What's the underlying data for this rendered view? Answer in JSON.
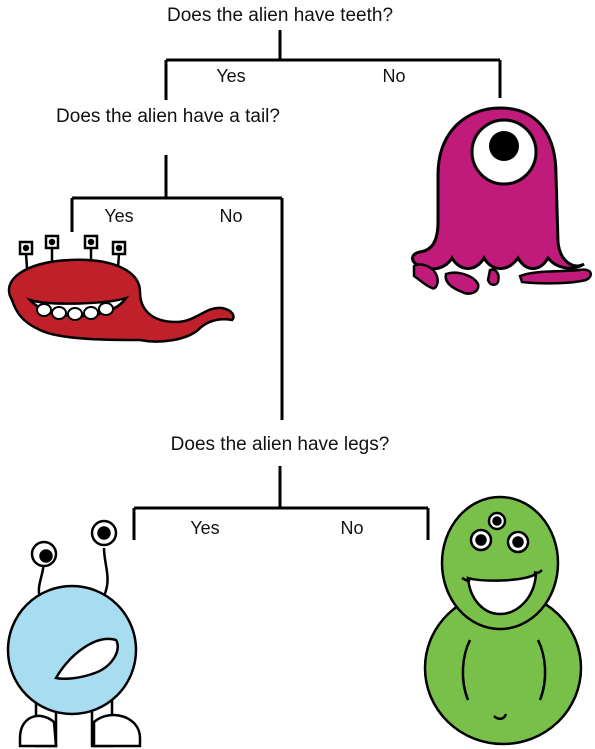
{
  "questions": {
    "teeth": "Does the alien have teeth?",
    "tail": "Does the alien have a tail?",
    "legs": "Does the alien have legs?"
  },
  "answers": {
    "teeth_yes": "Yes",
    "teeth_no": "No",
    "tail_yes": "Yes",
    "tail_no": "No",
    "legs_yes": "Yes",
    "legs_no": "No"
  },
  "colors": {
    "line": "#000000",
    "red_alien": "#c0202a",
    "magenta_alien": "#c01a7a",
    "blue_alien": "#a8dcf0",
    "green_alien": "#78c04a"
  }
}
